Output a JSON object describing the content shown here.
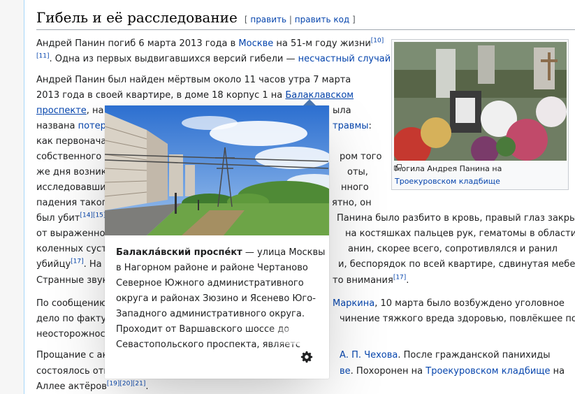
{
  "heading": {
    "title": "Гибель и её расследование",
    "edit_open": "[",
    "edit_link": "править",
    "edit_sep": " | ",
    "edit_code_link": "править код",
    "edit_close": "]"
  },
  "para1": {
    "l1_a": "Андрей Панин погиб 6 марта 2013 года в ",
    "l1_link": "Москве",
    "l1_b": " на 51-м году жизни",
    "l1_ref": "[10]",
    "l2_ref": "[11]",
    "l2_a": ". Одна из первых выдвигавшихся версий гибели — ",
    "l2_link": "несчастный случай",
    "l2_b": "."
  },
  "para2": {
    "l1": "Андрей Панин был найден мёртвым около 11 часов утра 7 марта",
    "l2_a": "2013 года в своей квартире, в доме 18 корпус 1 на ",
    "l2_link": "Балаклавском",
    "l3_link": "проспекте",
    "l3_a": ", на к",
    "l3_b": "ыла",
    "l4_a": "названа ",
    "l4_link_a": "потеря",
    "l4_link_b": "травмы",
    "l4_b": ":",
    "l5": "как первоначал",
    "l6_a": "собственного р",
    "l6_b": "ром того",
    "l7_a": "же дня возникл",
    "l7_b": "оты,",
    "l8_a": "исследовавшие",
    "l8_b": "нного",
    "l9_a": "падения такого",
    "l9_b": "ятно, он",
    "l10_a": "был убит",
    "l10_refs": "[14][15]",
    "l10_b": "Панина было разбито в кровь, правый глаз закрылся",
    "l11_a": "от выраженной",
    "l11_b": "на костяшках пальцев рук, гематомы в области",
    "l12_a": "коленных суста",
    "l12_b": "анин, скорее всего, сопротивлялся и ранил",
    "l13_a": "убийцу",
    "l13_ref": "[17]",
    "l13_b": ". На т",
    "l13_c": "и, беспорядок по всей квартире, сдвинутая мебель.",
    "l14_a": "Странные звук",
    "l14_b": "то внимания",
    "l14_ref": "[17]",
    "l14_c": "."
  },
  "para3": {
    "l1_a": "По сообщению",
    "l1_link": "Маркина",
    "l1_b": ", 10 марта было возбуждено уголовное",
    "l2_a": "дело по факту",
    "l2_b": "чинение тяжкого вреда здоровью, повлёкшее по",
    "l3": "неосторожност"
  },
  "para4": {
    "l1_a": "Прощание с акт",
    "l1_link": "А. П. Чехова",
    "l1_b": ". После гражданской панихиды",
    "l2_a": "состоялось отп",
    "l2_link_a": "ве",
    "l2_b": ". Похоронен на ",
    "l2_link_b": "Троекуровском кладбище",
    "l2_c": " на",
    "l3_a": "Аллее актёров",
    "l3_refs": "[19][20][21]",
    "l3_b": "."
  },
  "thumb": {
    "caption_a": "Могила Андрея Панина на",
    "caption_link": "Троекуровском кладбище"
  },
  "popup": {
    "title": "Балакла́вский проспе́кт",
    "line1_rest": " — улица Москвы",
    "line2": "в Нагорном районе и районе Чертаново",
    "line3": "Северное Южного административного",
    "line4": "округа и районах Зюзино и Ясенево Юго-",
    "line5": "Западного административного округа.",
    "line6": "Проходит от Варшавского шоссе до",
    "line7": "Севастопольского проспекта, являетс"
  },
  "icons": [
    "magnify-clip-icon",
    "gear-icon"
  ]
}
